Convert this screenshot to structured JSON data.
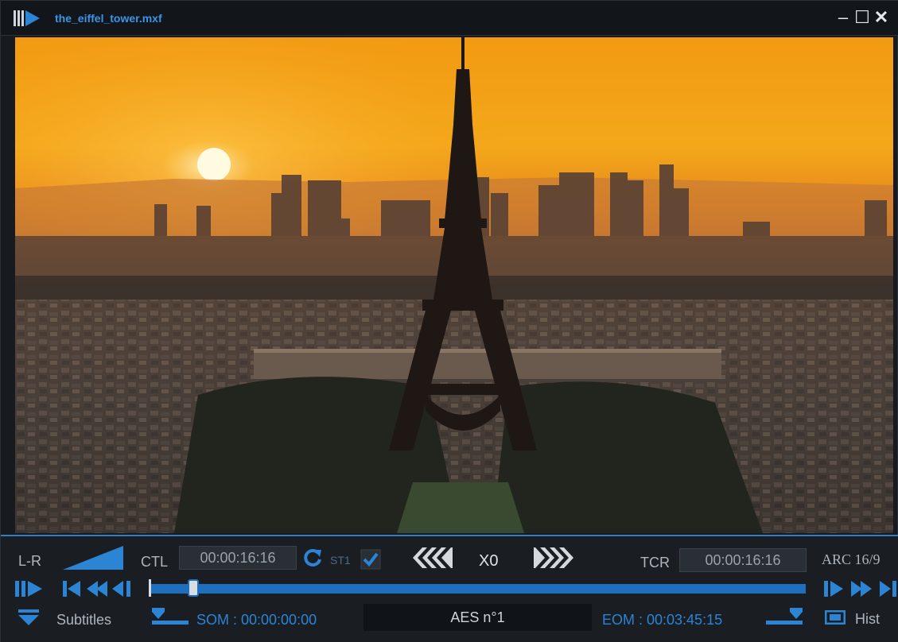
{
  "window": {
    "title": "the_eiffel_tower.mxf",
    "min_label": "–",
    "max_label": "☐",
    "close_label": "✕"
  },
  "video": {
    "scene": "Eiffel Tower at sunset over Paris skyline"
  },
  "controls": {
    "audio_channel_label": "L-R",
    "ctl_label": "CTL",
    "ctl_time": "00:00:16:16",
    "st1_label": "ST1",
    "st1_checked": true,
    "speed_label": "X0",
    "tcr_label": "TCR",
    "tcr_time": "00:00:16:16",
    "arc_label": "ARC 16/9",
    "subtitles_label": "Subtitles",
    "som_label": "SOM : 00:00:00:00",
    "aes_label": "AES n°1",
    "eom_label": "EOM : 00:03:45:15",
    "hist_label": "Hist",
    "position_fraction": 0.068
  },
  "colors": {
    "accent": "#2b84d4",
    "panel": "#1a1e23",
    "title": "#3a95e6"
  }
}
